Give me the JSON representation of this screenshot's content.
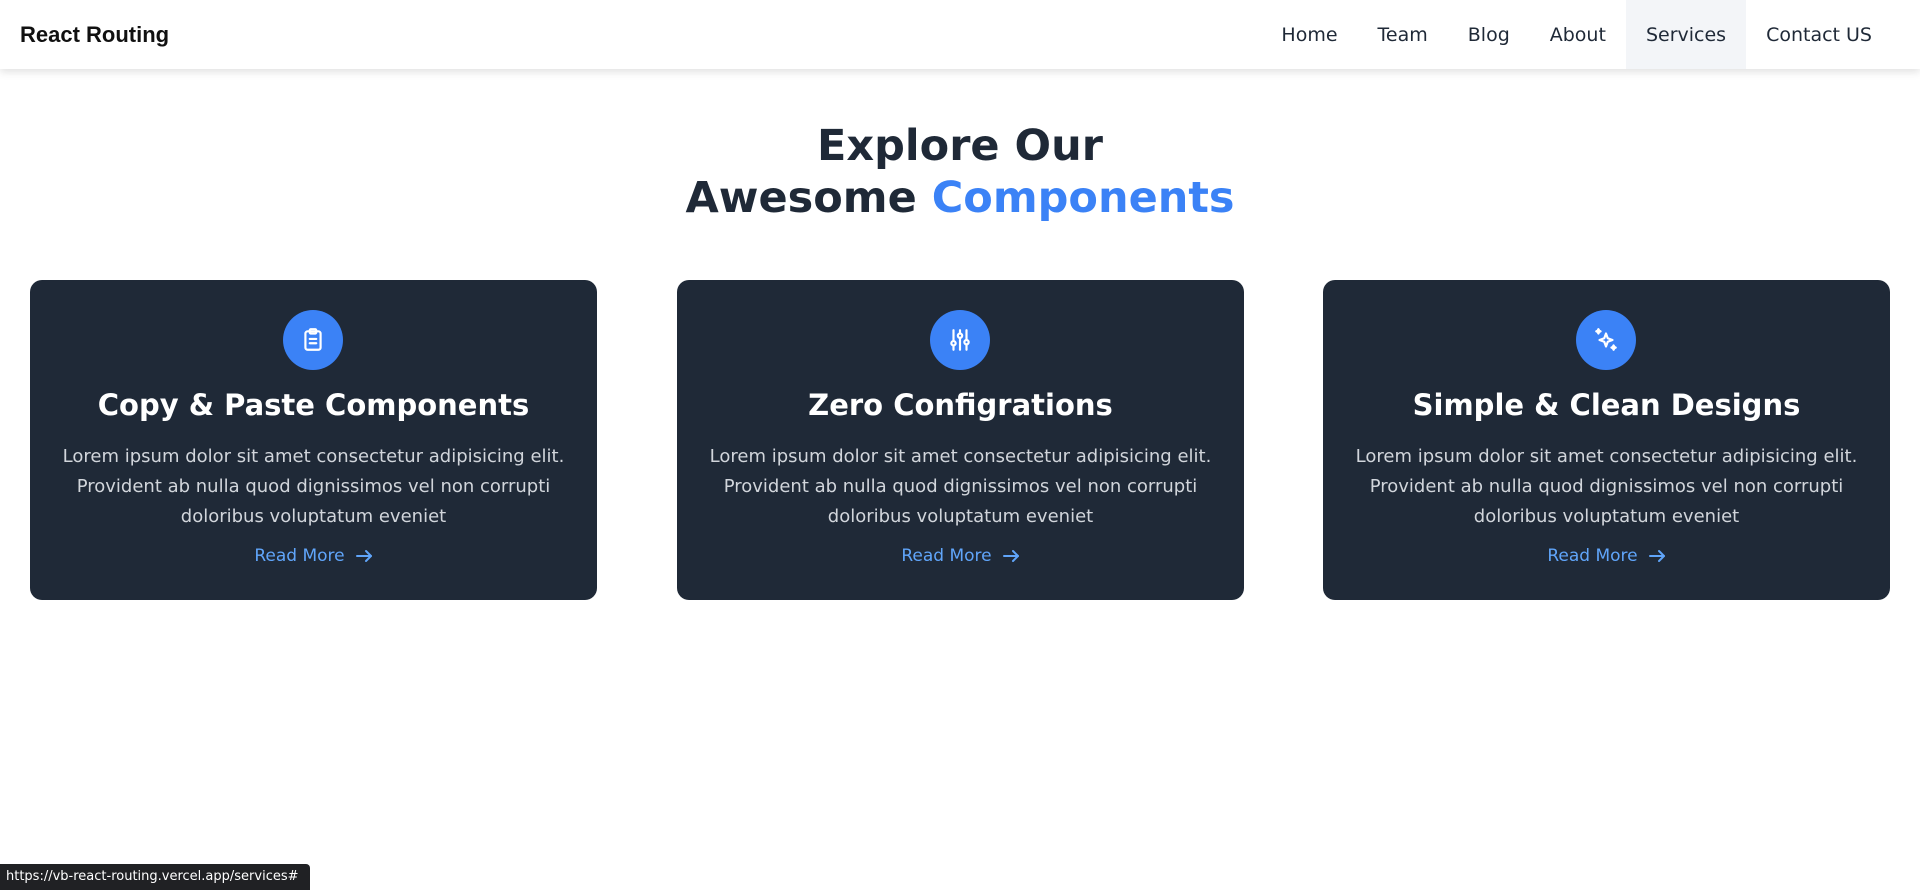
{
  "navbar": {
    "brand": "React Routing",
    "links": [
      "Home",
      "Team",
      "Blog",
      "About",
      "Services",
      "Contact US"
    ],
    "active": "Services"
  },
  "hero": {
    "line1": "Explore Our",
    "line2_prefix": "Awesome",
    "line2_accent": "Components"
  },
  "cards": [
    {
      "icon": "clipboard-icon",
      "title": "Copy & Paste Components",
      "text": "Lorem ipsum dolor sit amet consectetur adipisicing elit. Provident ab nulla quod dignissimos vel non corrupti doloribus voluptatum eveniet",
      "link": "Read More"
    },
    {
      "icon": "sliders-icon",
      "title": "Zero Configrations",
      "text": "Lorem ipsum dolor sit amet consectetur adipisicing elit. Provident ab nulla quod dignissimos vel non corrupti doloribus voluptatum eveniet",
      "link": "Read More"
    },
    {
      "icon": "sparkles-icon",
      "title": "Simple & Clean Designs",
      "text": "Lorem ipsum dolor sit amet consectetur adipisicing elit. Provident ab nulla quod dignissimos vel non corrupti doloribus voluptatum eveniet",
      "link": "Read More"
    }
  ],
  "status_bar": "https://vb-react-routing.vercel.app/services#",
  "colors": {
    "accent": "#3b82f6",
    "card_bg": "#1f2937",
    "link": "#60a5fa"
  }
}
